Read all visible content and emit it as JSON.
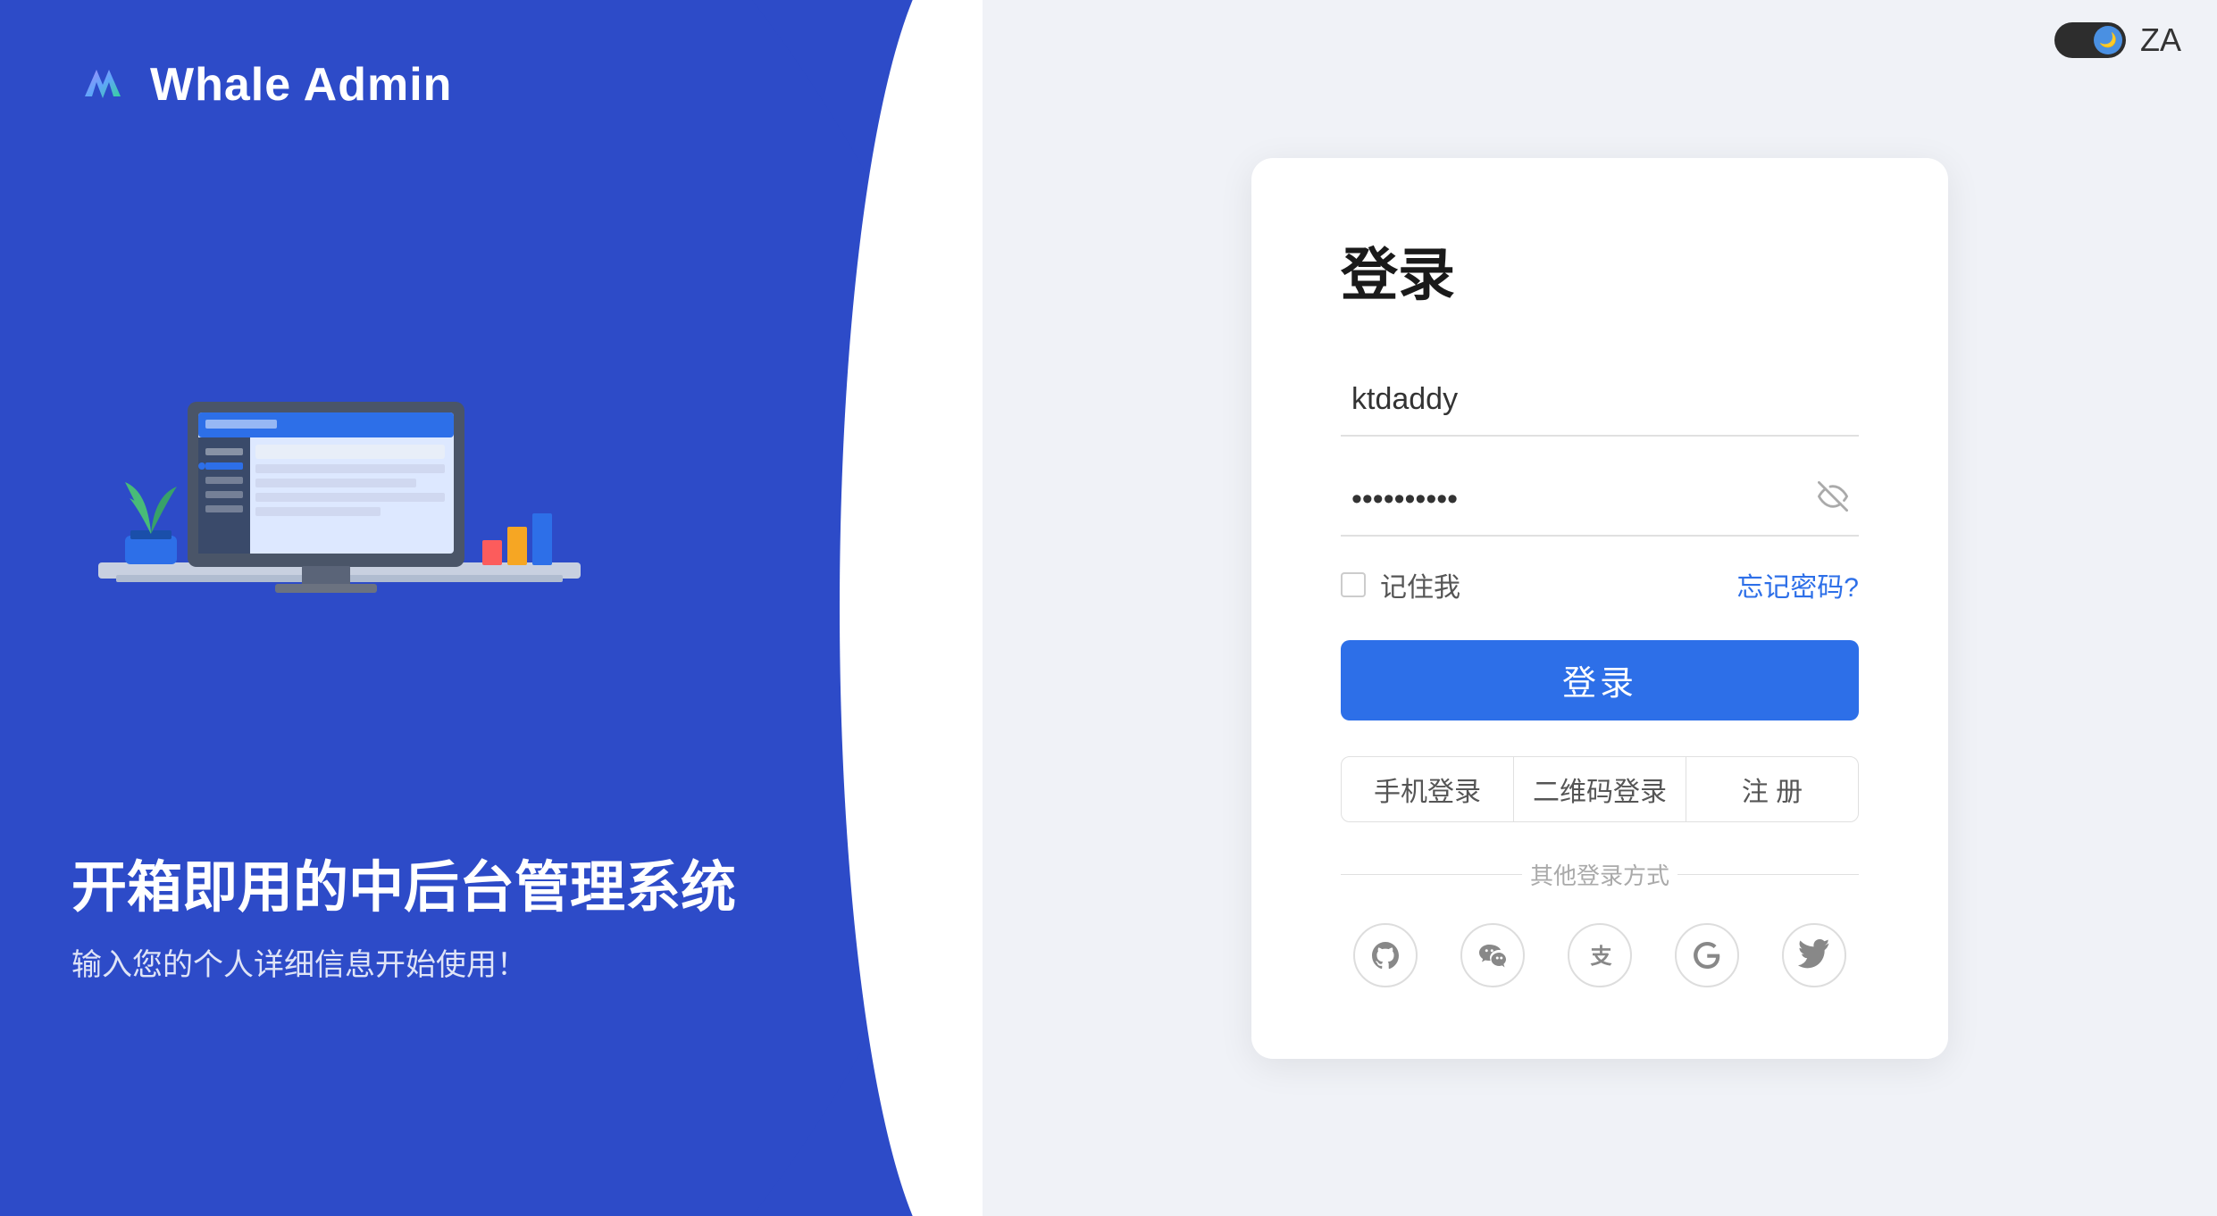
{
  "app": {
    "title": "Whale Admin",
    "logo_alt": "whale-logo"
  },
  "header": {
    "dark_mode_toggle_label": "dark-mode",
    "lang_label": "ZA"
  },
  "left_panel": {
    "tagline_main": "开箱即用的中后台管理系统",
    "tagline_sub": "输入您的个人详细信息开始使用！"
  },
  "login": {
    "title": "登录",
    "username_placeholder": "ktdaddy",
    "username_value": "ktdaddy",
    "password_placeholder": "••••••••••",
    "remember_label": "记住我",
    "forgot_label": "忘记密码?",
    "login_button": "登录",
    "alt_tabs": [
      {
        "label": "手机登录",
        "id": "phone"
      },
      {
        "label": "二维码登录",
        "id": "qrcode"
      },
      {
        "label": "注 册",
        "id": "register"
      }
    ],
    "social_divider": "其他登录方式",
    "social_icons": [
      {
        "name": "github-icon",
        "symbol": "⑆"
      },
      {
        "name": "wechat-icon",
        "symbol": "◎"
      },
      {
        "name": "alipay-icon",
        "symbol": "支"
      },
      {
        "name": "google-icon",
        "symbol": "G"
      },
      {
        "name": "twitter-icon",
        "symbol": "🐦"
      }
    ]
  },
  "colors": {
    "brand_blue": "#2d6fe8",
    "left_bg": "#2d4bc8",
    "right_bg": "#f0f2f7"
  }
}
